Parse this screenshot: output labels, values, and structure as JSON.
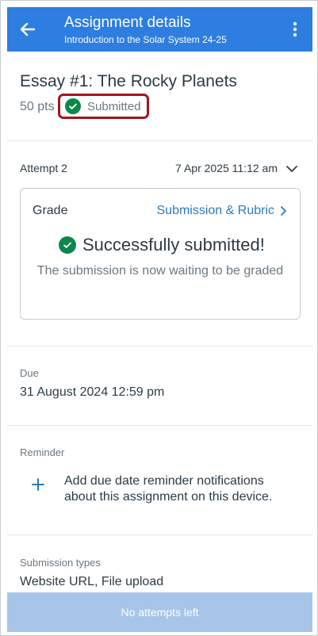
{
  "header": {
    "title": "Assignment details",
    "subtitle": "Introduction to the Solar System  24-25",
    "back_icon": "arrow-left-icon",
    "menu_icon": "kebab-menu-icon",
    "brand_color": "#2d7ee0"
  },
  "assignment": {
    "title": "Essay #1: The Rocky Planets",
    "points": "50 pts",
    "status": "Submitted",
    "status_color": "#0b874b"
  },
  "attempt": {
    "label": "Attempt 2",
    "date": "7 Apr 2025 11:12 am"
  },
  "grade_card": {
    "label": "Grade",
    "link": "Submission & Rubric",
    "success": "Successfully submitted!",
    "message": "The submission is now waiting to be graded"
  },
  "due": {
    "label": "Due",
    "value": "31 August 2024 12:59 pm"
  },
  "reminder": {
    "label": "Reminder",
    "text": "Add due date reminder notifications about this assignment on this device."
  },
  "submission_types": {
    "label": "Submission types",
    "value": "Website URL, File upload"
  },
  "footer": {
    "button": "No attempts left"
  }
}
